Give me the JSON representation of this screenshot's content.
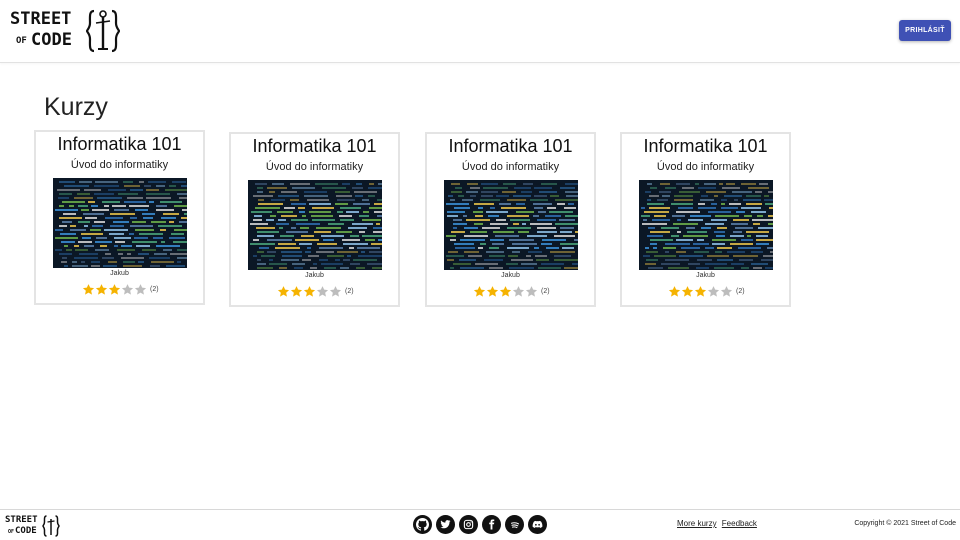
{
  "header": {
    "logo": {
      "line1": "STREET",
      "line2_small": "OF",
      "line2": "CODE"
    },
    "login_button": "PRIHLÁSIŤ"
  },
  "main": {
    "title": "Kurzy",
    "courses": [
      {
        "title": "Informatika 101",
        "subtitle": "Úvod do informatiky",
        "author": "Jakub",
        "rating": 3,
        "max_rating": 5,
        "reviews": "(2)"
      },
      {
        "title": "Informatika 101",
        "subtitle": "Úvod do informatiky",
        "author": "Jakub",
        "rating": 3,
        "max_rating": 5,
        "reviews": "(2)"
      },
      {
        "title": "Informatika 101",
        "subtitle": "Úvod do informatiky",
        "author": "Jakub",
        "rating": 3,
        "max_rating": 5,
        "reviews": "(2)"
      },
      {
        "title": "Informatika 101",
        "subtitle": "Úvod do informatiky",
        "author": "Jakub",
        "rating": 3,
        "max_rating": 5,
        "reviews": "(2)"
      }
    ]
  },
  "footer": {
    "logo": {
      "line1": "STREET",
      "line2_small": "OF",
      "line2": "CODE"
    },
    "socials": [
      "github-icon",
      "twitter-icon",
      "instagram-icon",
      "facebook-icon",
      "spotify-icon",
      "discord-icon"
    ],
    "links": [
      "More kurzy",
      "Feedback"
    ],
    "copyright": "Copyright © 2021 Street of Code"
  },
  "colors": {
    "accent": "#3f51b5",
    "star_filled": "#f5b301",
    "star_empty": "#bdbdbd"
  }
}
